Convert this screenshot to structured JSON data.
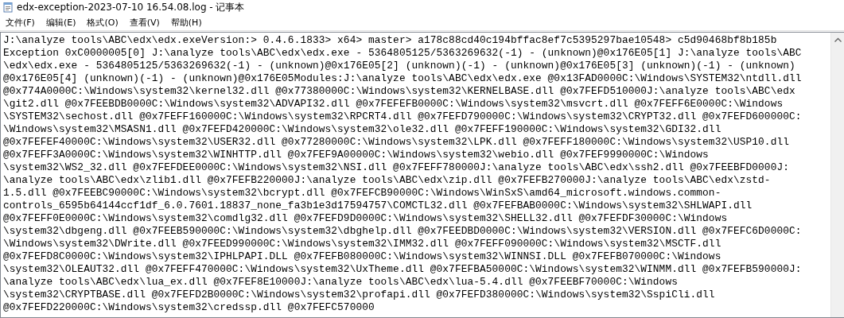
{
  "window": {
    "title": "edx-exception-2023-07-10 16.54.08.log - 记事本"
  },
  "menu": [
    "文件(F)",
    "编辑(E)",
    "格式(O)",
    "查看(V)",
    "帮助(H)"
  ],
  "document": {
    "lines": [
      "J:\\analyze tools\\ABC\\edx\\edx.exeVersion:> 0.4.6.1833> x64> master> a178c88cd40c194bffac8ef7c5395297bae10548> c5d90468bf8b185b",
      "Exception 0xC0000005[0] J:\\analyze tools\\ABC\\edx\\edx.exe - 5364805125/5363269632(-1) - (unknown)@0x176E05[1] J:\\analyze tools\\ABC",
      "\\edx\\edx.exe - 5364805125/5363269632(-1) - (unknown)@0x176E05[2] (unknown)(-1) - (unknown)@0x176E05[3] (unknown)(-1) - (unknown)",
      "@0x176E05[4] (unknown)(-1) - (unknown)@0x176E05Modules:J:\\analyze tools\\ABC\\edx\\edx.exe @0x13FAD0000C:\\Windows\\SYSTEM32\\ntdll.dll",
      "@0x774A0000C:\\Windows\\system32\\kernel32.dll @0x77380000C:\\Windows\\system32\\KERNELBASE.dll @0x7FEFD510000J:\\analyze tools\\ABC\\edx",
      "\\git2.dll @0x7FEEBDB0000C:\\Windows\\system32\\ADVAPI32.dll @0x7FEFEFB0000C:\\Windows\\system32\\msvcrt.dll @0x7FEFF6E0000C:\\Windows",
      "\\SYSTEM32\\sechost.dll @0x7FEFF160000C:\\Windows\\system32\\RPCRT4.dll @0x7FEFD790000C:\\Windows\\system32\\CRYPT32.dll @0x7FEFD600000C:",
      "\\Windows\\system32\\MSASN1.dll @0x7FEFD420000C:\\Windows\\system32\\ole32.dll @0x7FEFF190000C:\\Windows\\system32\\GDI32.dll",
      "@0x7FEFEF40000C:\\Windows\\system32\\USER32.dll @0x77280000C:\\Windows\\system32\\LPK.dll @0x7FEFF180000C:\\Windows\\system32\\USP10.dll",
      "@0x7FEFF3A0000C:\\Windows\\system32\\WINHTTP.dll @0x7FEF9A00000C:\\Windows\\system32\\webio.dll @0x7FEF9990000C:\\Windows",
      "\\system32\\WS2_32.dll @0x7FEFDEE0000C:\\Windows\\system32\\NSI.dll @0x7FEFF780000J:\\analyze tools\\ABC\\edx\\ssh2.dll @0x7FEEBFD0000J:",
      "\\analyze tools\\ABC\\edx\\zlib1.dll @0x7FEFB220000J:\\analyze tools\\ABC\\edx\\zip.dll @0x7FEFB270000J:\\analyze tools\\ABC\\edx\\zstd-",
      "1.5.dll @0x7FEEBC90000C:\\Windows\\system32\\bcrypt.dll @0x7FEFCB90000C:\\Windows\\WinSxS\\amd64_microsoft.windows.common-",
      "controls_6595b64144ccf1df_6.0.7601.18837_none_fa3b1e3d17594757\\COMCTL32.dll @0x7FEFBAB0000C:\\Windows\\system32\\SHLWAPI.dll",
      "@0x7FEFF0E0000C:\\Windows\\system32\\comdlg32.dll @0x7FEFD9D0000C:\\Windows\\system32\\SHELL32.dll @0x7FEFDF30000C:\\Windows",
      "\\system32\\dbgeng.dll @0x7FEEB590000C:\\Windows\\system32\\dbghelp.dll @0x7FEEDBD0000C:\\Windows\\system32\\VERSION.dll @0x7FEFC6D0000C:",
      "\\Windows\\system32\\DWrite.dll @0x7FEED990000C:\\Windows\\system32\\IMM32.dll @0x7FEFF090000C:\\Windows\\system32\\MSCTF.dll",
      "@0x7FEFD8C0000C:\\Windows\\system32\\IPHLPAPI.DLL @0x7FEFB080000C:\\Windows\\system32\\WINNSI.DLL @0x7FEFB070000C:\\Windows",
      "\\system32\\OLEAUT32.dll @0x7FEFF470000C:\\Windows\\system32\\UxTheme.dll @0x7FEFBA50000C:\\Windows\\system32\\WINMM.dll @0x7FEFB590000J:",
      "\\analyze tools\\ABC\\edx\\lua_ex.dll @0x7FEF8E10000J:\\analyze tools\\ABC\\edx\\lua-5.4.dll @0x7FEEBF70000C:\\Windows",
      "\\system32\\CRYPTBASE.dll @0x7FEFD2B0000C:\\Windows\\system32\\profapi.dll @0x7FEFD380000C:\\Windows\\system32\\SspiCli.dll",
      "@0x7FEFD220000C:\\Windows\\system32\\credssp.dll @0x7FEFC570000"
    ]
  }
}
